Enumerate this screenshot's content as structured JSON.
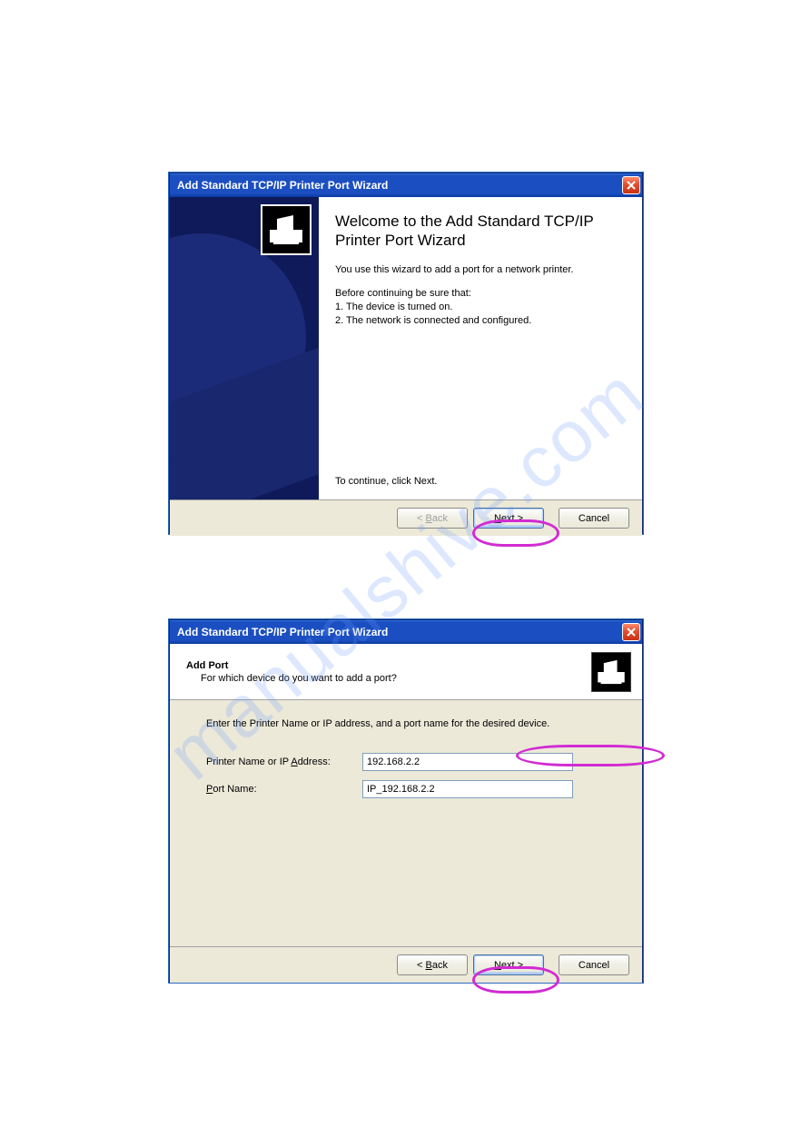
{
  "watermark": "manualshive.com",
  "dialog1": {
    "title": "Add Standard TCP/IP Printer Port Wizard",
    "heading": "Welcome to the Add Standard TCP/IP Printer Port Wizard",
    "intro": "You use this wizard to add a port for a network printer.",
    "before": "Before continuing be sure that:",
    "item1": "1.  The device is turned on.",
    "item2": "2.  The network is connected and configured.",
    "continue": "To continue, click Next.",
    "buttons": {
      "back": "< Back",
      "next": "Next >",
      "cancel": "Cancel"
    }
  },
  "dialog2": {
    "title": "Add Standard TCP/IP Printer Port Wizard",
    "subtitle_bold": "Add Port",
    "subtitle_line": "For which device do you want to add a port?",
    "instruction": "Enter the Printer Name or IP address, and a port name for the desired device.",
    "label_ip_pre": "Printer Name or IP ",
    "label_ip_u": "A",
    "label_ip_post": "ddress:",
    "label_port_u": "P",
    "label_port_post": "ort Name:",
    "value_ip": "192.168.2.2",
    "value_port": "IP_192.168.2.2",
    "buttons": {
      "back": "< Back",
      "next": "Next >",
      "cancel": "Cancel"
    }
  }
}
